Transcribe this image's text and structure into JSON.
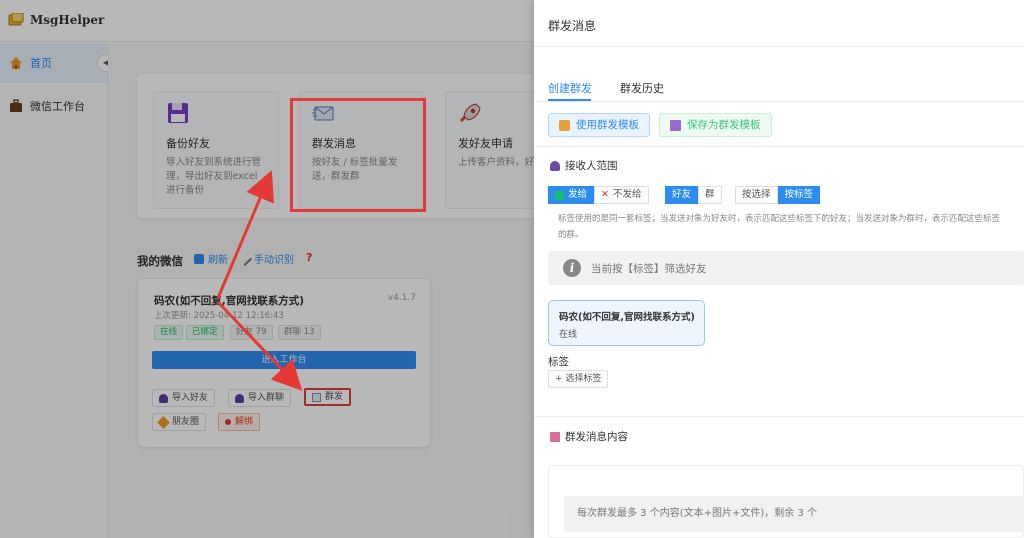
{
  "app": {
    "name": "MsgHelper"
  },
  "sidebar": {
    "items": [
      {
        "label": "首页",
        "icon": "home-icon",
        "active": true
      },
      {
        "label": "微信工作台",
        "icon": "briefcase-icon",
        "active": false
      }
    ]
  },
  "quick_actions": [
    {
      "title": "备份好友",
      "desc": "导入好友到系统进行管理，导出好友到excel进行备份",
      "icon": "floppy-icon"
    },
    {
      "title": "群发消息",
      "desc": "按好友 / 标签批量发送，群发群",
      "icon": "mail-icon"
    },
    {
      "title": "发好友申请",
      "desc": "上传客户资料，好友申请",
      "icon": "rocket-icon"
    }
  ],
  "my_wechat": {
    "title": "我的微信",
    "refresh_label": "刷新",
    "manual_label": "手动识别",
    "help": "?"
  },
  "account": {
    "name": "码农(如不回复,官网找联系方式)",
    "version": "v4.1.7",
    "updated": "上次更新: 2025-04-12 12:16:43",
    "tags": [
      {
        "label": "在线",
        "style": "green"
      },
      {
        "label": "已绑定",
        "style": "green"
      },
      {
        "label": "好友 79",
        "style": "gray"
      },
      {
        "label": "群聊 13",
        "style": "gray"
      }
    ],
    "enter_label": "进入工作台",
    "buttons": [
      {
        "label": "导入好友",
        "icon": "user-icon"
      },
      {
        "label": "导入群聊",
        "icon": "users-icon"
      },
      {
        "label": "群发",
        "icon": "mail-icon"
      },
      {
        "label": "朋友圈",
        "icon": "pencil-icon"
      },
      {
        "label": "解绑",
        "icon": "pin-icon"
      }
    ]
  },
  "drawer": {
    "title": "群发消息",
    "tabs": [
      {
        "label": "创建群发",
        "active": true
      },
      {
        "label": "群发历史",
        "active": false
      }
    ],
    "use_template_label": "使用群发模板",
    "save_template_label": "保存为群发模板",
    "recipients_title": "接收人范围",
    "send_toggle": {
      "send": "发给",
      "nosend": "不发给"
    },
    "target_toggle": {
      "friend": "好友",
      "group": "群"
    },
    "mode_toggle": {
      "select": "按选择",
      "tag": "按标签"
    },
    "tag_note_line1": "标签使用的是同一套标签；当发送对象为好友时，表示匹配这些标签下的好友；当发送对象为群时，表示匹配这些标签",
    "tag_note_line2": "的群。",
    "info_text": "当前按【标签】筛选好友",
    "selected_account": {
      "name": "码农(如不回复,官网找联系方式)",
      "status": "在线"
    },
    "tag_label": "标签",
    "pick_tag_label": "+ 选择标签",
    "content_title": "群发消息内容",
    "content_hint": "每次群发最多 3 个内容(文本+图片+文件)，剩余 3 个"
  },
  "colors": {
    "primary": "#2d8cf0",
    "success": "#19be6b",
    "danger": "#e53935"
  }
}
